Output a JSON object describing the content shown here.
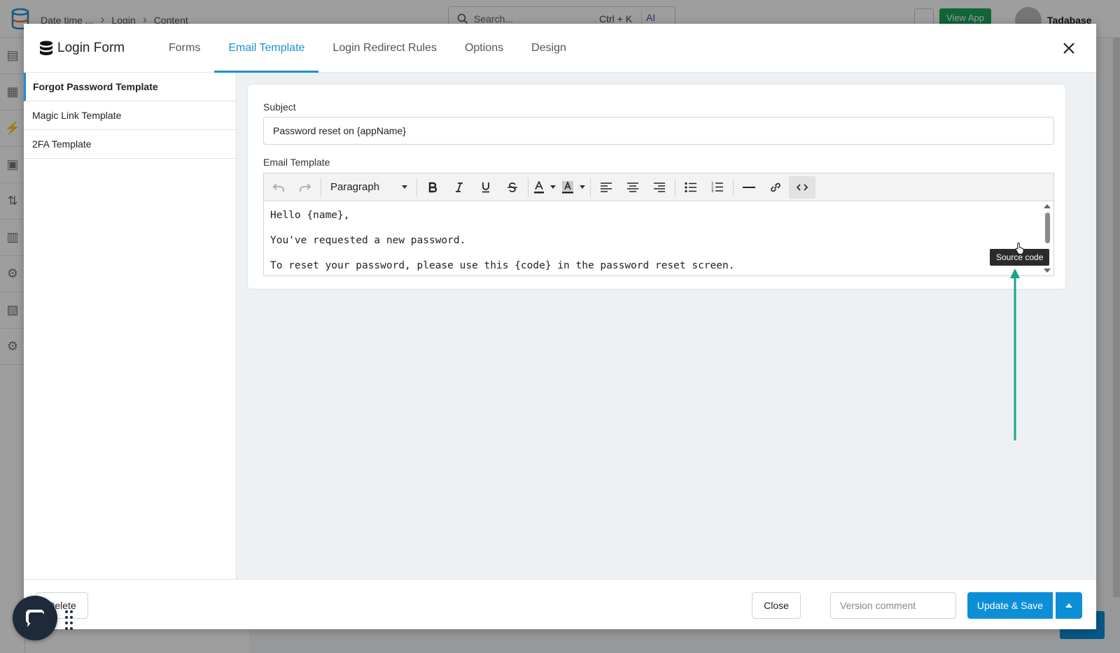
{
  "background_app": {
    "breadcrumbs": [
      "Date time ...",
      "Login",
      "Content"
    ],
    "search": {
      "placeholder": "Search...",
      "shortcut": "Ctrl + K",
      "ai_label": "AI"
    },
    "view_app_label": "View App",
    "user_name": "Tadabase"
  },
  "modal": {
    "title": "Login Form",
    "tabs": [
      {
        "label": "Forms",
        "active": false
      },
      {
        "label": "Email Template",
        "active": true
      },
      {
        "label": "Login Redirect Rules",
        "active": false
      },
      {
        "label": "Options",
        "active": false
      },
      {
        "label": "Design",
        "active": false
      }
    ],
    "sidebar": {
      "items": [
        {
          "label": "Forgot Password Template",
          "active": true
        },
        {
          "label": "Magic Link Template",
          "active": false
        },
        {
          "label": "2FA Template",
          "active": false
        }
      ]
    },
    "form": {
      "subject_label": "Subject",
      "subject_value": "Password reset on {appName}",
      "email_template_label": "Email Template",
      "block_format": "Paragraph",
      "body_lines": [
        "Hello {name},",
        "You've requested a new password.",
        "To reset your password, please use this {code} in the password reset screen."
      ],
      "tooltip": "Source code"
    },
    "footer": {
      "delete_label": "Delete",
      "close_label": "Close",
      "version_placeholder": "Version comment",
      "save_label": "Update & Save"
    }
  },
  "colors": {
    "accent": "#1d8fd6",
    "primary_button": "#0d8fd8",
    "annotation_arrow": "#1aa389",
    "view_app_green": "#1aa35c"
  }
}
